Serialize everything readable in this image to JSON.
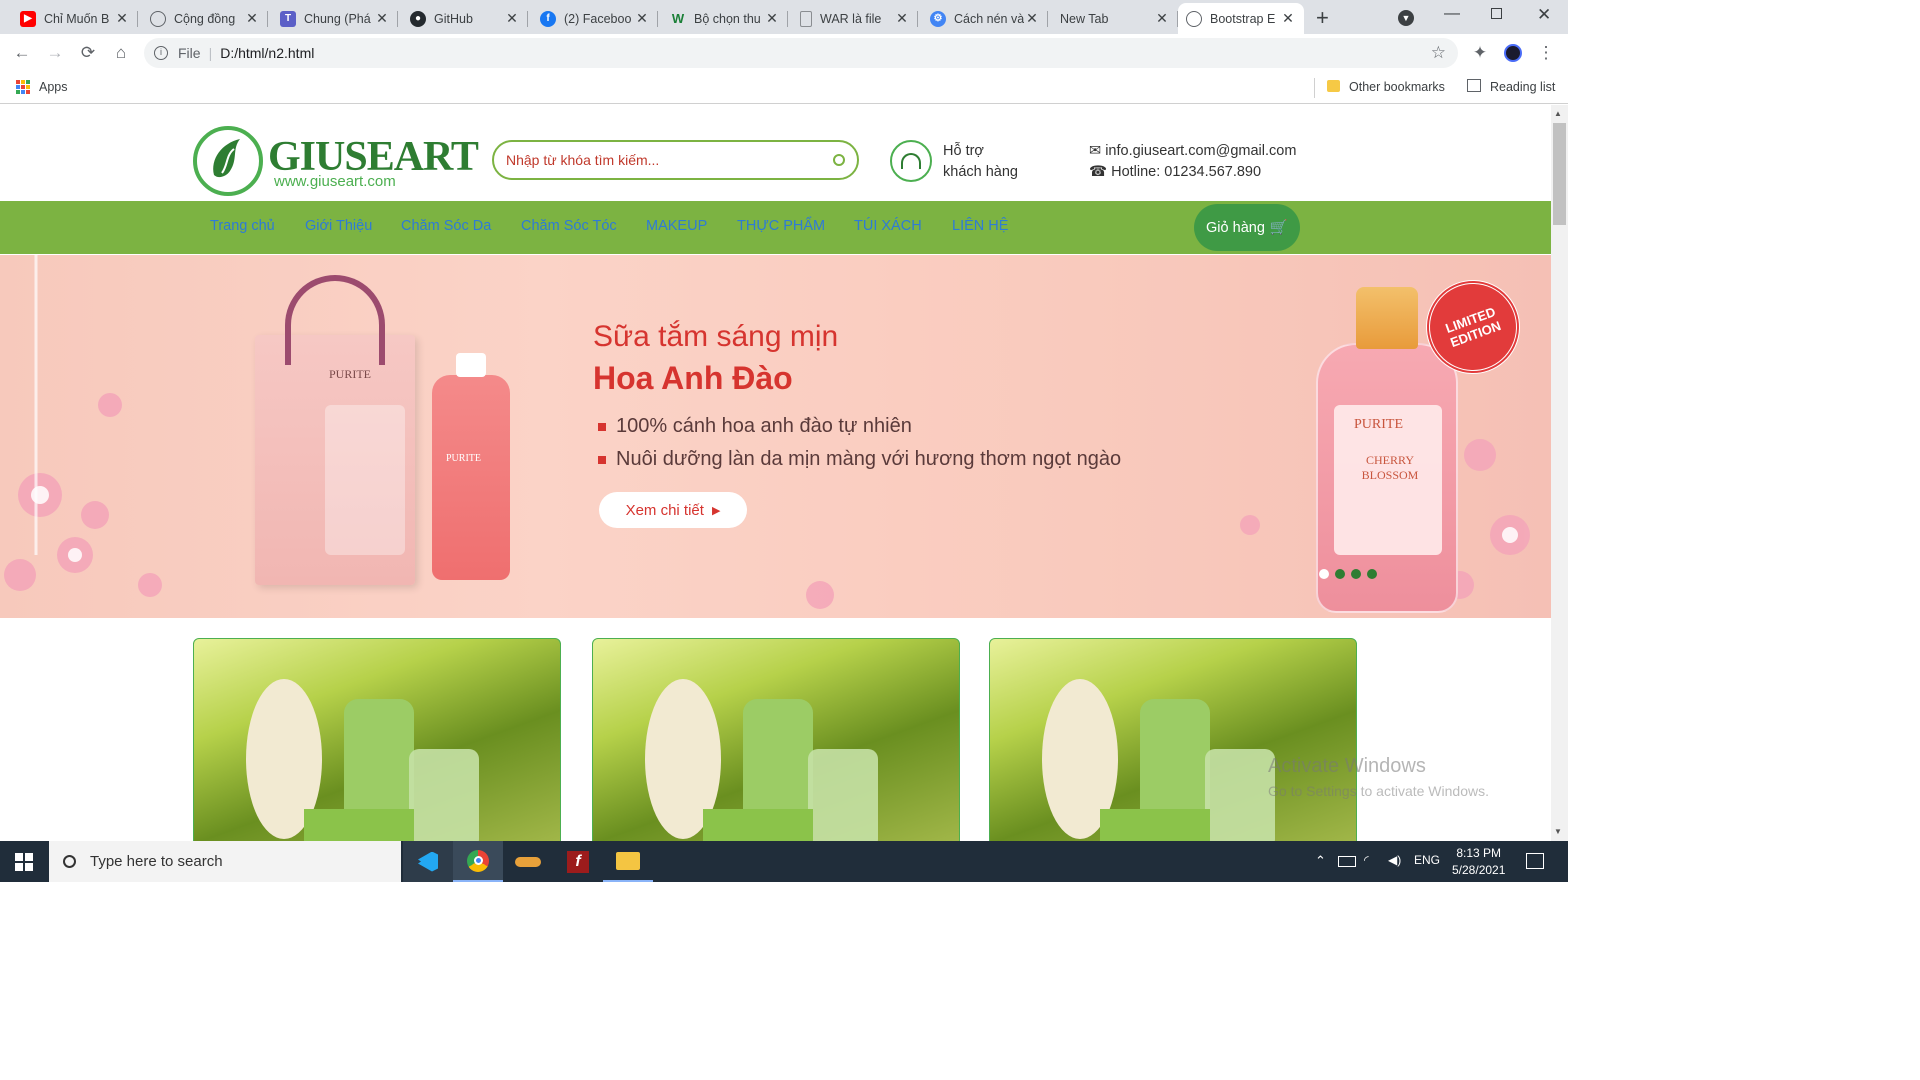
{
  "browser": {
    "tabs": [
      {
        "label": "Chỉ Muốn B",
        "icon": "youtube-icon",
        "color": "#ff0000"
      },
      {
        "label": "Cộng đồng",
        "icon": "globe-icon",
        "color": "#5f6368"
      },
      {
        "label": "Chung (Phá",
        "icon": "teams-icon",
        "color": "#5b5fc7"
      },
      {
        "label": "GitHub",
        "icon": "github-icon",
        "color": "#24292e"
      },
      {
        "label": "(2) Faceboo",
        "icon": "facebook-icon",
        "color": "#1877f2"
      },
      {
        "label": "Bộ chọn thu",
        "icon": "w-icon",
        "color": "#1a7f37"
      },
      {
        "label": "WAR là file",
        "icon": "document-icon",
        "color": "#5f6368"
      },
      {
        "label": "Cách nén và",
        "icon": "tool-icon",
        "color": "#4285f4"
      },
      {
        "label": "New Tab",
        "icon": "",
        "color": ""
      },
      {
        "label": "Bootstrap E",
        "icon": "globe-icon",
        "color": "#5f6368"
      }
    ],
    "address": {
      "scheme_label": "File",
      "url": "D:/html/n2.html"
    },
    "bookmarks": {
      "apps": "Apps",
      "other": "Other bookmarks",
      "reading": "Reading list"
    }
  },
  "site": {
    "logo_text": "GIUSEART",
    "logo_url": "www.giuseart.com",
    "search_placeholder": "Nhập từ khóa tìm kiếm...",
    "support_line1": "Hỗ trợ",
    "support_line2": "khách hàng",
    "email": "info.giuseart.com@gmail.com",
    "hotline": "Hotline: 01234.567.890",
    "nav": [
      "Trang chủ",
      "Giới Thiệu",
      "Chăm Sóc Da",
      "Chăm Sóc Tóc",
      "MAKEUP",
      "THỰC PHẨM",
      "TÚI XÁCH",
      "LIÊN HỆ"
    ],
    "cart": "Giỏ hàng",
    "colors": {
      "green": "#7cb342",
      "dark_green": "#3f9a45",
      "nav_text": "#2e7bd6",
      "banner_red": "#d6342f"
    }
  },
  "banner": {
    "headline": "Sữa tắm sáng mịn",
    "product": "Hoa Anh Đào",
    "bullets": [
      "100% cánh hoa anh đào tự nhiên",
      "Nuôi dưỡng làn da mịn màng với hương thơm ngọt ngào"
    ],
    "cta": "Xem chi tiết",
    "box_brand": "PURITE",
    "bottle_brand": "PURITE",
    "bottle_label": "CHERRY BLOSSOM",
    "seal": "LIMITED EDITION",
    "slides": 4,
    "active_slide": 1
  },
  "watermark": {
    "title": "Activate Windows",
    "sub": "Go to Settings to activate Windows."
  },
  "taskbar": {
    "search_placeholder": "Type here to search",
    "lang": "ENG",
    "time": "8:13 PM",
    "date": "5/28/2021"
  }
}
